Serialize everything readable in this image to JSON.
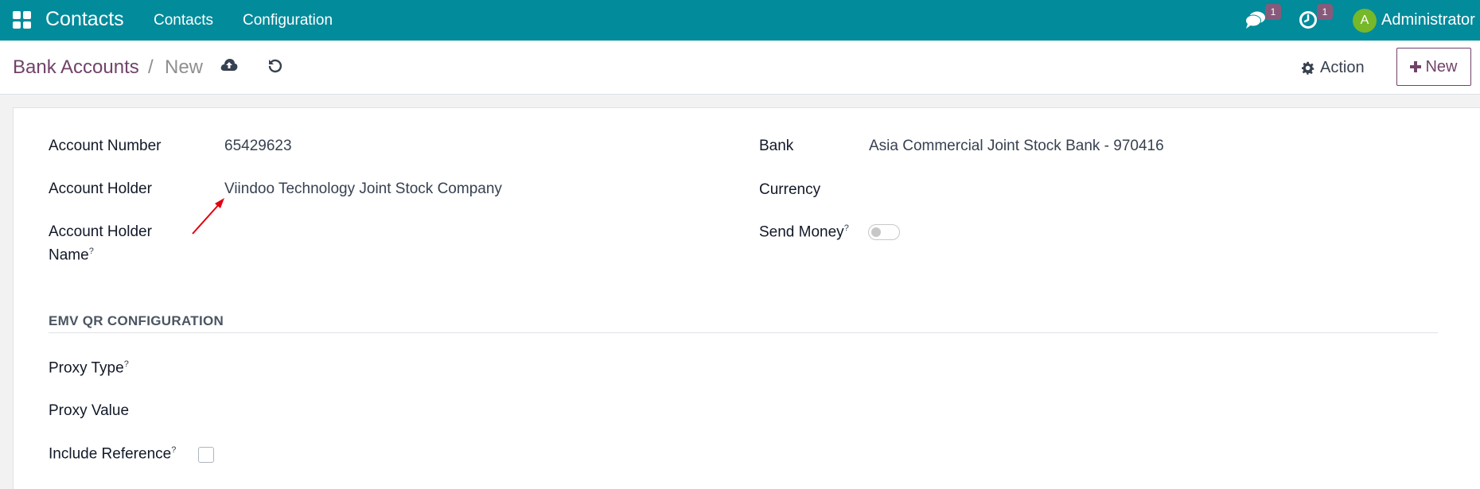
{
  "navbar": {
    "app_name": "Contacts",
    "menu": [
      "Contacts",
      "Configuration"
    ],
    "messages_count": "1",
    "activities_count": "1",
    "user_initial": "A",
    "user_name": "Administrator",
    "bg_color": "#018b9b"
  },
  "control_panel": {
    "breadcrumb_parent": "Bank Accounts",
    "breadcrumb_separator": "/",
    "breadcrumb_current": "New",
    "save_icon": "cloud-upload-icon",
    "discard_icon": "undo-icon",
    "action_label": "Action",
    "new_label": "New"
  },
  "form": {
    "left": [
      {
        "label": "Account Number",
        "value": "65429623"
      },
      {
        "label": "Account Holder",
        "value": "Viindoo Technology Joint Stock Company"
      },
      {
        "label_line1": "Account Holder",
        "label_line2": "Name",
        "help": "?",
        "value": ""
      }
    ],
    "right": [
      {
        "label": "Bank",
        "value": "Asia Commercial Joint Stock Bank - 970416"
      },
      {
        "label": "Currency",
        "value": ""
      },
      {
        "label": "Send Money",
        "help": "?",
        "toggle_on": false
      }
    ],
    "section": {
      "title": "EMV QR CONFIGURATION",
      "fields": [
        {
          "label": "Proxy Type",
          "help": "?"
        },
        {
          "label": "Proxy Value"
        },
        {
          "label": "Include Reference",
          "help": "?",
          "checked": false
        }
      ]
    }
  },
  "annotation": {
    "arrow_color": "#e3000f"
  }
}
